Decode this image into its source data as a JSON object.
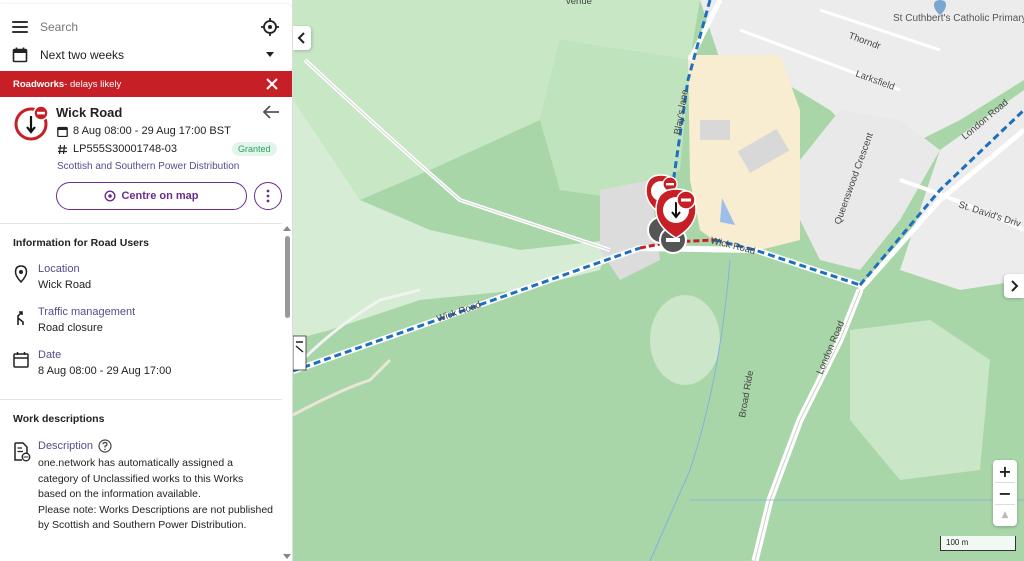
{
  "search": {
    "placeholder": "Search"
  },
  "date_filter": {
    "selected": "Next two weeks"
  },
  "alert": {
    "category": "Roadworks",
    "message": " - delays likely"
  },
  "works": {
    "title": "Wick Road",
    "dates": "8 Aug 08:00 - 29 Aug 17:00 BST",
    "reference": "LP555S30001748-03",
    "status": "Granted",
    "promoter": "Scottish and Southern Power Distribution",
    "centre_label": "Centre on map"
  },
  "info_section": {
    "title": "Information for Road Users",
    "items": [
      {
        "label": "Location",
        "value": "Wick Road",
        "icon": "location-pin-icon"
      },
      {
        "label": "Traffic management",
        "value": "Road closure",
        "icon": "traffic-management-icon"
      },
      {
        "label": "Date",
        "value": "8 Aug 08:00 - 29 Aug 17:00",
        "icon": "calendar-icon"
      }
    ]
  },
  "work_desc": {
    "title": "Work descriptions",
    "label": "Description",
    "text": "one.network has automatically assigned a category of Unclassified works to this Works based on the information available.\nPlease note: Works Descriptions are not published by Scottish and Southern Power Distribution."
  },
  "map_labels": {
    "venue": "venue",
    "school": "St Cuthbert's Catholic Primary School",
    "thornd": "Thorndr",
    "larksfield": "Larksfield",
    "blays_lane": "Blay's lane",
    "queenswood": "Queenswood Crescent",
    "london_road_top": "London Road",
    "st_davids": "St. David's Driv",
    "wick_road_1": "Wick Road",
    "wick_road_2": "Wick Road",
    "london_road": "London Road",
    "broad_ride": "Broad Ride"
  },
  "zoom": {
    "in": "+",
    "out": "−",
    "compass": "▲"
  },
  "scale": {
    "label": "100 m"
  },
  "colors": {
    "alert_red": "#c62026",
    "accent_purple": "#6a2c91",
    "granted_green": "#2f9e60",
    "diversion_blue": "#1f6fbf",
    "map_green": "#b9deb8"
  }
}
